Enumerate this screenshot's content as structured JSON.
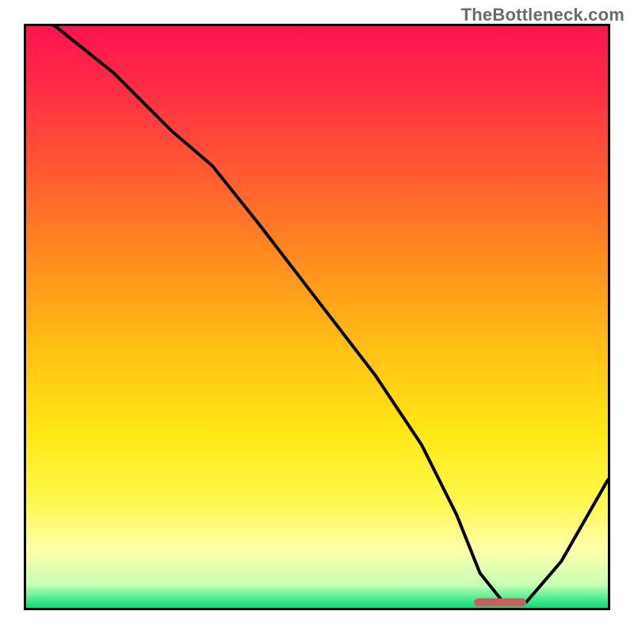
{
  "watermark": "TheBottleneck.com",
  "colors": {
    "frame_border": "#000000",
    "curve": "#000000",
    "marker": "#cd5c5c",
    "gradient_stops": [
      {
        "offset": 0.0,
        "color": "#ff1450"
      },
      {
        "offset": 0.1,
        "color": "#ff2a46"
      },
      {
        "offset": 0.25,
        "color": "#ff5a32"
      },
      {
        "offset": 0.4,
        "color": "#ff8c1e"
      },
      {
        "offset": 0.55,
        "color": "#ffbf14"
      },
      {
        "offset": 0.7,
        "color": "#ffe814"
      },
      {
        "offset": 0.82,
        "color": "#fff850"
      },
      {
        "offset": 0.9,
        "color": "#ffffaa"
      },
      {
        "offset": 0.96,
        "color": "#c8ffb4"
      },
      {
        "offset": 1.0,
        "color": "#00e07a"
      }
    ]
  },
  "chart_data": {
    "type": "line",
    "title": "",
    "xlabel": "",
    "ylabel": "",
    "xlim": [
      0,
      100
    ],
    "ylim": [
      0,
      100
    ],
    "series": [
      {
        "name": "bottleneck-curve",
        "x": [
          0,
          5,
          15,
          25,
          32,
          40,
          50,
          60,
          68,
          74,
          78,
          82,
          86,
          92,
          100
        ],
        "y": [
          102,
          100,
          92,
          82,
          76,
          66,
          53,
          40,
          28,
          16,
          6,
          1,
          1,
          8,
          22
        ]
      }
    ],
    "marker": {
      "x_start": 77,
      "x_end": 86,
      "y": 0.5
    }
  }
}
